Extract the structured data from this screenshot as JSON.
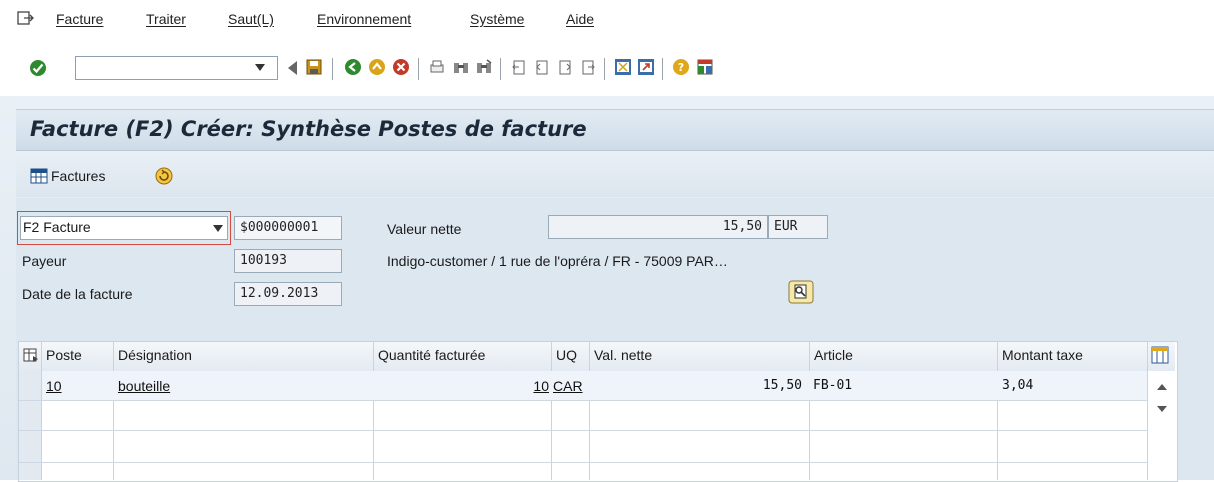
{
  "menu": {
    "items": [
      "Facture",
      "Traiter",
      "Saut(L)",
      "Environnement",
      "Système",
      "Aide"
    ]
  },
  "toolbar": {
    "command_value": "",
    "icons": [
      "check-icon",
      "back-icon",
      "save-icon",
      "back-green-icon",
      "exit-icon",
      "cancel-icon",
      "print-icon",
      "find-icon",
      "find-next-icon",
      "first-page-icon",
      "prev-page-icon",
      "next-page-icon",
      "last-page-icon",
      "new-session-icon",
      "shortcut-icon",
      "help-icon",
      "layout-icon"
    ]
  },
  "screen": {
    "title": "Facture (F2) Créer: Synthèse Postes de facture"
  },
  "app_toolbar": {
    "invoices_label": "Factures"
  },
  "header": {
    "doc_type": "F2 Facture",
    "doc_number": "$000000001",
    "net_value_label": "Valeur nette",
    "net_value": "15,50",
    "currency": "EUR",
    "payer_label": "Payeur",
    "payer": "100193",
    "payer_address": "Indigo-customer / 1 rue de l'opréra / FR - 75009 PAR…",
    "date_label": "Date de la facture",
    "date": "12.09.2013"
  },
  "table": {
    "columns": [
      "Poste",
      "Désignation",
      "Quantité facturée",
      "UQ",
      "Val. nette",
      "Article",
      "Montant taxe"
    ],
    "rows": [
      {
        "poste": "10",
        "designation": "bouteille",
        "quantite": "10",
        "uq": "CAR",
        "val_nette": "15,50",
        "article": "FB-01",
        "montant_taxe": "3,04"
      }
    ]
  }
}
